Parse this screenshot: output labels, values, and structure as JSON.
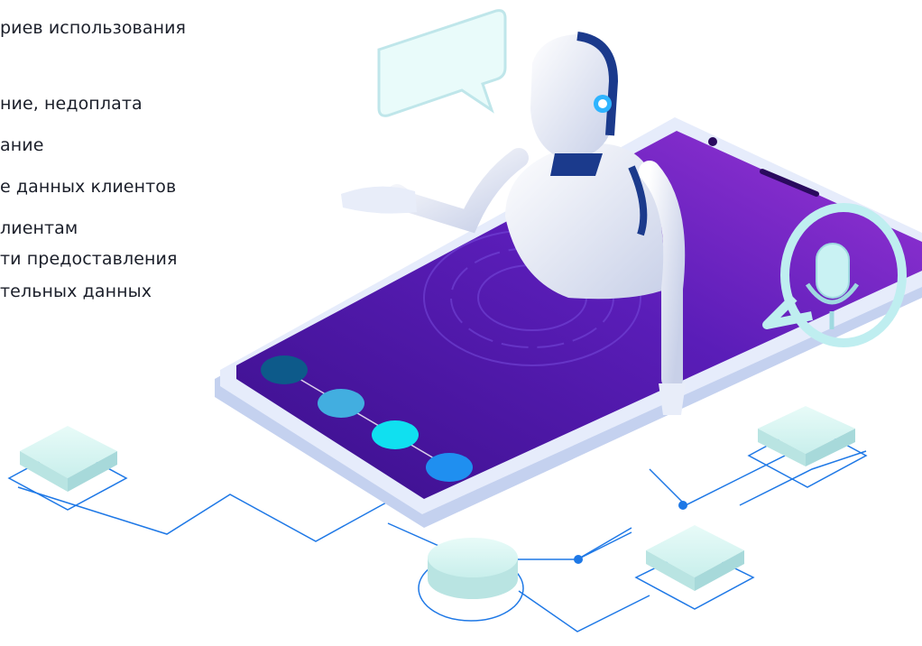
{
  "text_lines": [
    "риев использования",
    "ние, недоплата",
    "ание",
    "е данных клиентов",
    "лиентам",
    "ти предоставления",
    "тельных данных"
  ],
  "colors": {
    "phone_purple": "#5a1db8",
    "phone_violet": "#8a2fd0",
    "frame": "#d9e2f7",
    "line_blue": "#1e78e6",
    "dot1": "#0d5a8a",
    "dot2": "#42aee0",
    "dot3": "#10e0f0",
    "dot4": "#1f8ff0",
    "tile": "#dff7f4"
  },
  "icons": [
    "speech-bubble-icon",
    "microphone-icon",
    "robot-figure"
  ]
}
